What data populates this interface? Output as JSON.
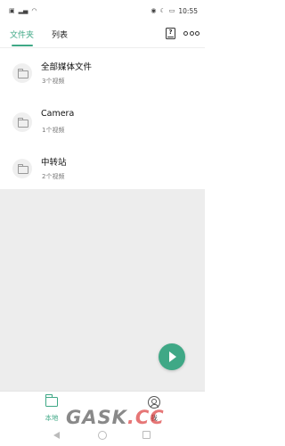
{
  "status_bar": {
    "left_icons": [
      "sim-icon",
      "signal-icon",
      "wifi-icon"
    ],
    "right_icons": [
      "eye-icon",
      "moon-icon",
      "battery-icon"
    ],
    "time": "10:55"
  },
  "tabs": [
    {
      "label": "文件夹",
      "active": true
    },
    {
      "label": "列表",
      "active": false
    }
  ],
  "toolbar_icons": [
    "help-book-icon",
    "more-icon"
  ],
  "folders": [
    {
      "name": "全部媒体文件",
      "count": "3个视频"
    },
    {
      "name": "Camera",
      "count": "1个视频"
    },
    {
      "name": "中转站",
      "count": "2个视频"
    }
  ],
  "bottom_nav": [
    {
      "label": "本地",
      "icon": "folder-icon",
      "active": true
    },
    {
      "label": "我",
      "icon": "user-icon",
      "active": false
    }
  ],
  "watermark": {
    "text_main": "GASK",
    "text_accent": ".CC"
  },
  "colors": {
    "accent": "#3fa886",
    "background": "#ededed"
  }
}
